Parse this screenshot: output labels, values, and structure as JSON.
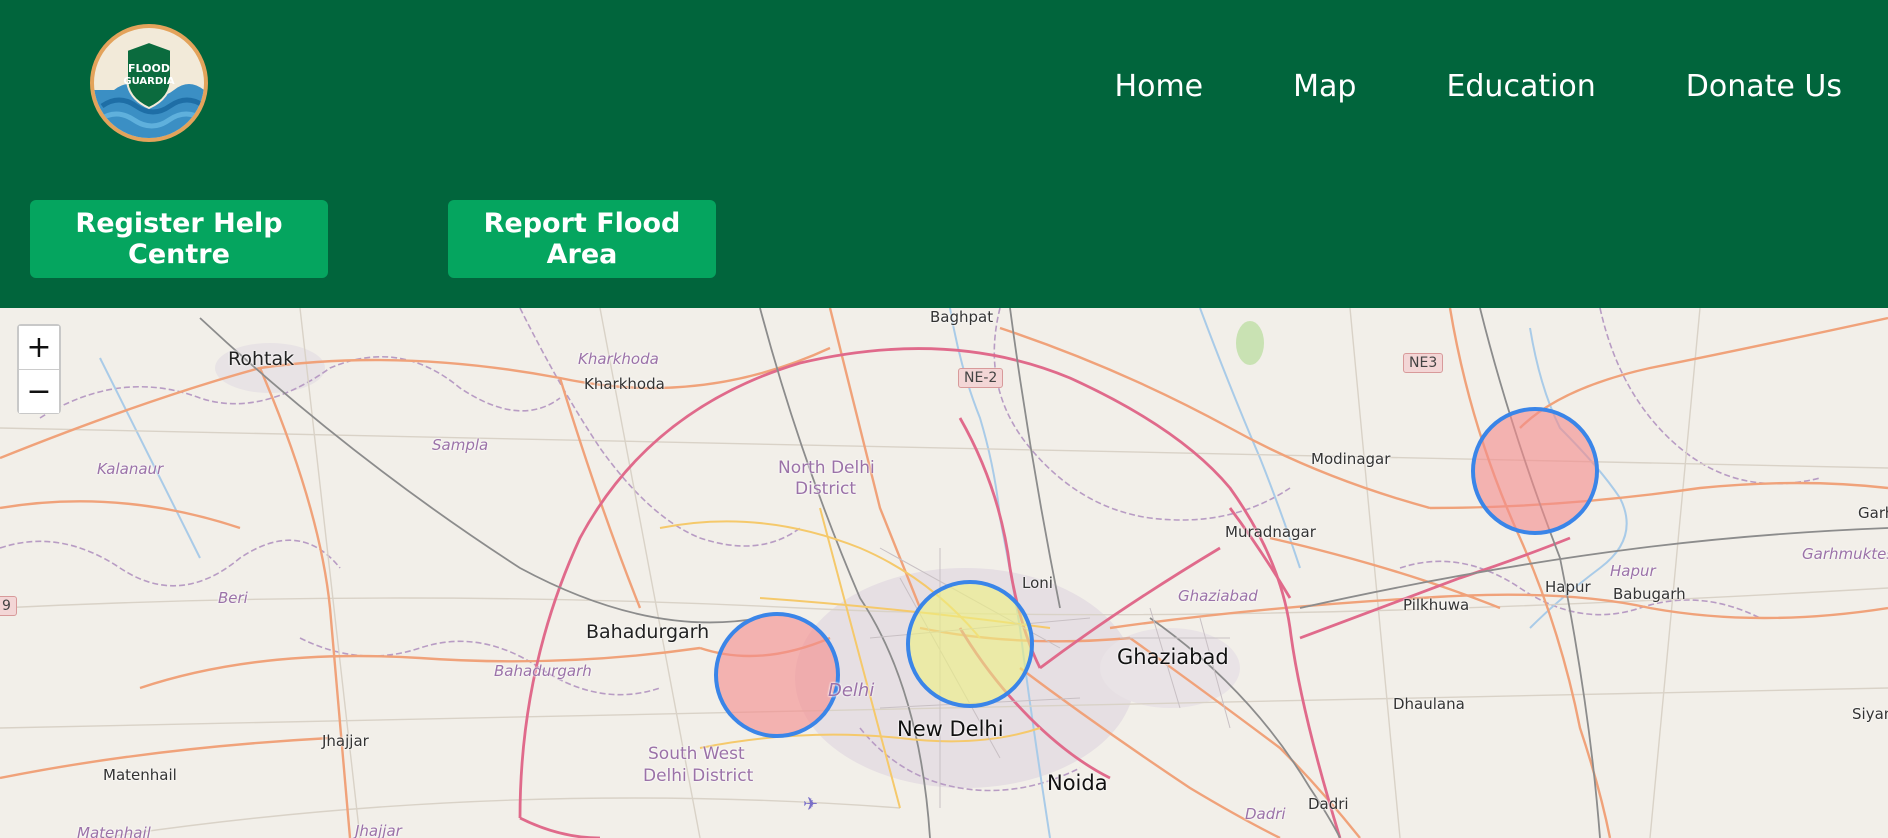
{
  "brand": {
    "logo_text_1": "FLOOD",
    "logo_text_2": "GUARDIA"
  },
  "nav": {
    "home": "Home",
    "map": "Map",
    "education": "Education",
    "donate": "Donate Us"
  },
  "actions": {
    "register": "Register Help Centre",
    "report": "Report Flood Area"
  },
  "map": {
    "zoom_in": "+",
    "zoom_out": "−",
    "labels": {
      "baghpat": "Baghpat",
      "rohtak": "Rohtak",
      "kharkhoda_d": "Kharkhoda",
      "kharkhoda": "Kharkhoda",
      "sampla": "Sampla",
      "kalanaur": "Kalanaur",
      "beri": "Beri",
      "north_delhi_1": "North Delhi",
      "north_delhi_2": "District",
      "bahadurgarh": "Bahadurgarh",
      "bahadurgarh_d": "Bahadurgarh",
      "modinagar": "Modinagar",
      "muradnagar": "Muradnagar",
      "loni": "Loni",
      "ghaziabad_d": "Ghaziabad",
      "ghaziabad": "Ghaziabad",
      "pilkhuwa": "Pilkhuwa",
      "hapur_d": "Hapur",
      "hapur": "Hapur",
      "babugarh": "Babugarh",
      "garhmukteshwar": "Garhmuktesh",
      "garh": "Garh",
      "delhi": "Delhi",
      "new_delhi": "New Delhi",
      "sw_delhi_1": "South West",
      "sw_delhi_2": "Delhi District",
      "jhajjar": "Jhajjar",
      "jhajjar_d": "Jhajjar",
      "matenhail": "Matenhail",
      "matenhail_d": "Matenhail",
      "dhaulana": "Dhaulana",
      "noida": "Noida",
      "dadri": "Dadri",
      "dadri_d": "Dadri",
      "siyana": "Siyan"
    },
    "shields": {
      "ne2": "NE-2",
      "ne3": "NE3",
      "edge": "9"
    },
    "zones": [
      {
        "id": "south-west-delhi",
        "severity": "high",
        "color": "#f4a4a4"
      },
      {
        "id": "central-delhi",
        "severity": "moderate",
        "color": "#eef08a"
      },
      {
        "id": "hapur",
        "severity": "high",
        "color": "#f4a4a4"
      }
    ]
  }
}
